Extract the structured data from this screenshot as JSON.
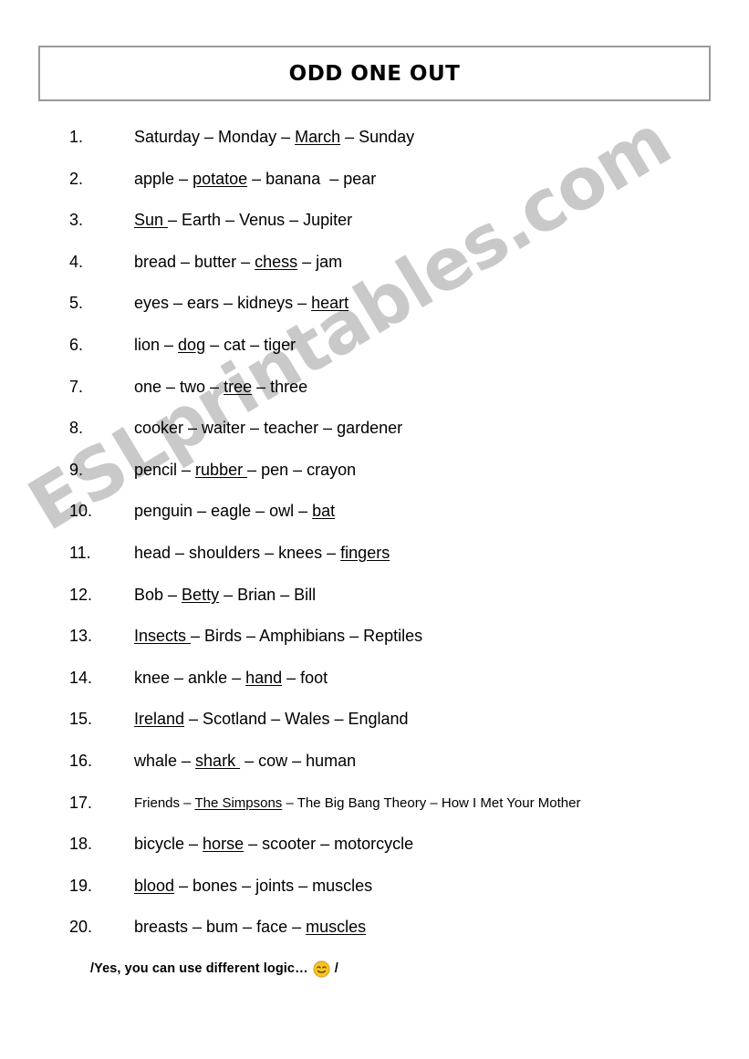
{
  "document": {
    "title": "ODD ONE OUT",
    "watermark": "ESLprintables.com",
    "watermark_color": "#c9c9c9",
    "border_color": "#9a9a9a",
    "background_color": "#ffffff",
    "text_color": "#000000"
  },
  "items": [
    {
      "number": "1.",
      "html": "Saturday &ndash; Monday &ndash; <u>March</u> &ndash; Sunday",
      "answer": "March"
    },
    {
      "number": "2.",
      "html": "apple &ndash; <u>potatoe</u> &ndash; banana &nbsp;&ndash; pear",
      "answer": "potatoe"
    },
    {
      "number": "3.",
      "html": "<u>Sun </u>&ndash; Earth &ndash; Venus &ndash; Jupiter",
      "answer": "Sun"
    },
    {
      "number": "4.",
      "html": "bread &ndash; butter &ndash; <u>chess</u> &ndash; jam",
      "answer": "chess"
    },
    {
      "number": "5.",
      "html": "eyes &ndash; ears &ndash; kidneys &ndash; <u>heart</u>",
      "answer": "heart"
    },
    {
      "number": "6.",
      "html": "lion &ndash; <u>dog</u> &ndash; cat &ndash; tiger",
      "answer": "dog"
    },
    {
      "number": "7.",
      "html": "one &ndash; two &ndash; <u>tree</u> &ndash; three",
      "answer": "tree"
    },
    {
      "number": "8.",
      "html": "cooker &ndash; waiter &ndash; teacher &ndash; gardener",
      "answer": ""
    },
    {
      "number": "9.",
      "html": "pencil &ndash; <u>rubber </u>&ndash; pen &ndash; crayon",
      "answer": "rubber"
    },
    {
      "number": "10.",
      "html": "penguin &ndash; eagle &ndash; owl &ndash; <u>bat</u>",
      "answer": "bat"
    },
    {
      "number": "11.",
      "html": "head &ndash; shoulders &ndash; knees &ndash; <u>fingers</u>",
      "answer": "fingers"
    },
    {
      "number": "12.",
      "html": "Bob &ndash; <u>Betty</u> &ndash; Brian &ndash; Bill",
      "answer": "Betty"
    },
    {
      "number": "13.",
      "html": "<u>Insects </u>&ndash; Birds &ndash; Amphibians &ndash; Reptiles",
      "answer": "Insects"
    },
    {
      "number": "14.",
      "html": "knee &ndash; ankle &ndash; <u>hand</u> &ndash; foot",
      "answer": "hand"
    },
    {
      "number": "15.",
      "html": "<u>Ireland</u> &ndash; Scotland &ndash; Wales &ndash; England",
      "answer": "Ireland"
    },
    {
      "number": "16.",
      "html": "whale &ndash; <u>shark </u>&nbsp;&ndash; cow &ndash; human",
      "answer": "shark"
    },
    {
      "number": "17.",
      "html": "Friends &ndash; <u>The Simpsons</u> &ndash; The Big Bang Theory &ndash; How I Met Your Mother",
      "answer": "The Simpsons",
      "small": true
    },
    {
      "number": "18.",
      "html": "bicycle &ndash; <u>horse</u> &ndash; scooter &ndash; motorcycle",
      "answer": "horse"
    },
    {
      "number": "19.",
      "html": "<u>blood</u> &ndash; bones &ndash; joints &ndash; muscles",
      "answer": "blood"
    },
    {
      "number": "20.",
      "html": "breasts &ndash; bum &ndash; face &ndash; <u>muscles</u>",
      "answer": "muscles"
    }
  ],
  "footer": {
    "prefix": "/Yes, you can use different logic…",
    "icon": "smiling-face-with-smiling-eyes-emoji",
    "suffix": "/",
    "emoji_fill": "#f7c325",
    "emoji_stroke": "#d79a1c"
  }
}
